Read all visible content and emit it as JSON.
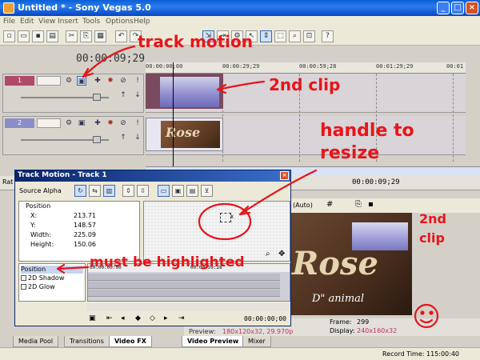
{
  "window": {
    "title": "Untitled * - Sony Vegas 5.0"
  },
  "menu": [
    "File",
    "Edit",
    "View",
    "Insert",
    "Tools",
    "Options",
    "Help"
  ],
  "timeline": {
    "current_time": "00:00:09;29",
    "ruler_ticks": [
      "00:00:00;00",
      "00:00:29;29",
      "00:00:59;28",
      "00:01:29;29",
      "00:01"
    ],
    "tracks": [
      {
        "number": "1"
      },
      {
        "number": "2"
      }
    ],
    "clip2_text": "Rose",
    "rate_label": "Rat",
    "cursor_time": "00:00:09;29"
  },
  "track_motion": {
    "title": "Track Motion - Track 1",
    "source_label": "Source Alpha",
    "position_group": "Position",
    "props": [
      {
        "key": "X:",
        "value": "213.71"
      },
      {
        "key": "Y:",
        "value": "148.57"
      },
      {
        "key": "Width:",
        "value": "225.09"
      },
      {
        "key": "Height:",
        "value": "150.06"
      }
    ],
    "canvas_label": "X",
    "keyframe_list": [
      "Position",
      "2D Shadow",
      "2D Glow"
    ],
    "kf_ruler": [
      "00:00:00:00",
      "00:00:59:28"
    ],
    "footer_time": "00:00:00;00"
  },
  "preview": {
    "auto_label": "(Auto)",
    "frame_label": "Frame:",
    "frame_value": "299",
    "display_label": "Display:",
    "display_value": "240x160x32",
    "preview_label": "Preview:",
    "preview_value": "180x120x32, 29.970p",
    "title_text": "Rose",
    "subtitle_text": "D\" animal"
  },
  "tabs_left": [
    "Media Pool",
    "Transitions",
    "Video FX"
  ],
  "tabs_right": [
    "Video Preview",
    "Mixer"
  ],
  "status": {
    "record_time": "Record Time: 115:00:40"
  },
  "annotations": {
    "track_motion": "track motion",
    "clip2_top": "2nd clip",
    "handle": "handle to resize",
    "highlighted": "must be highlighted",
    "clip2_right": "2nd clip",
    "color": "#e8141a"
  }
}
